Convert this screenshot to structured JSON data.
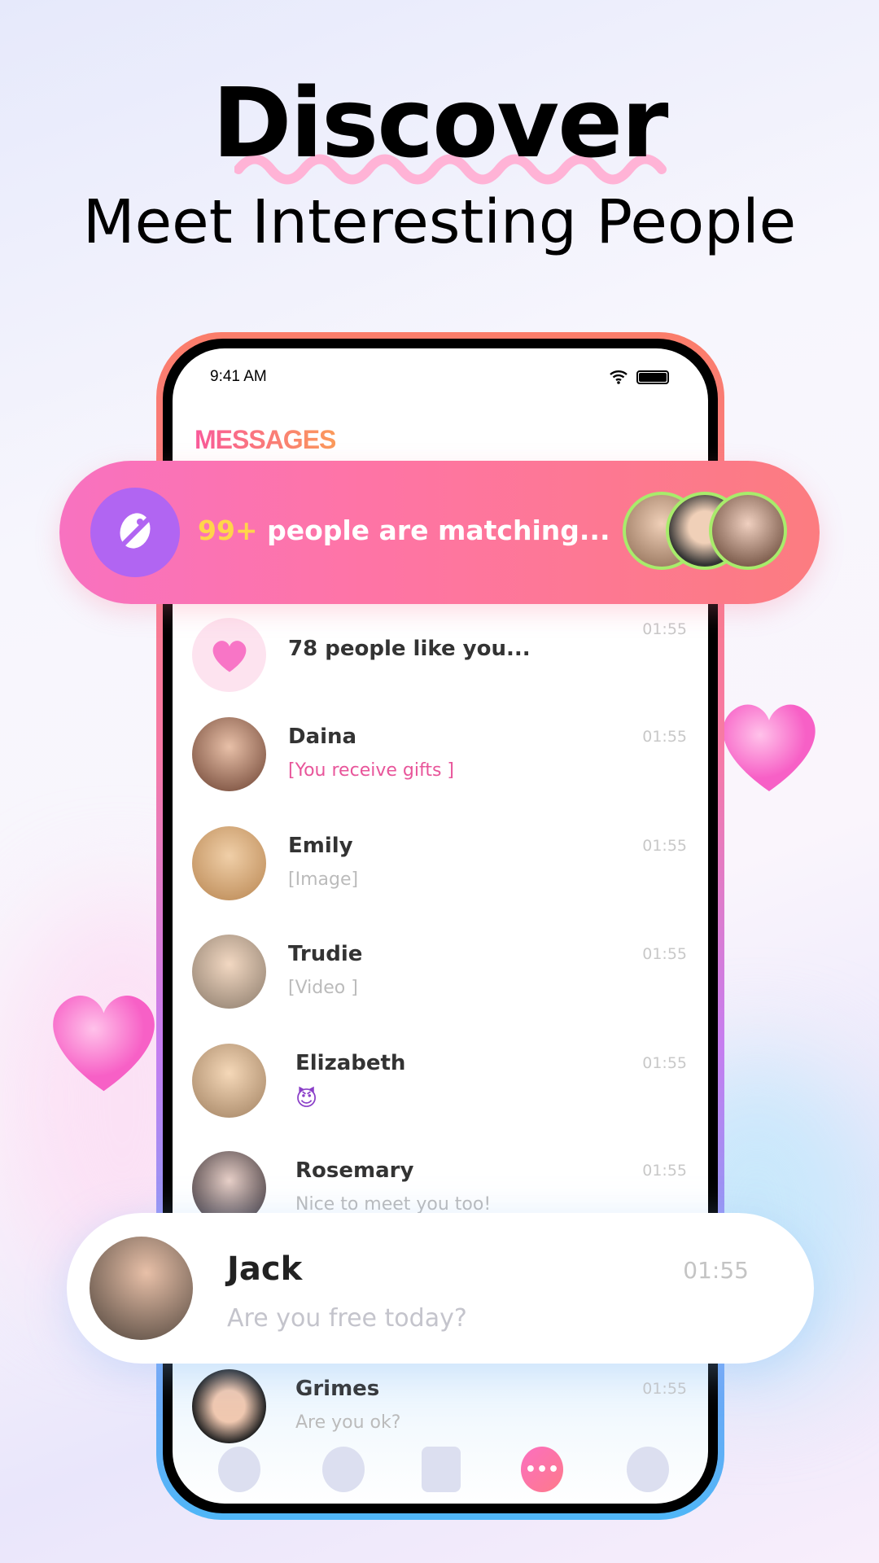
{
  "headline": {
    "title": "Discover",
    "subtitle": "Meet Interesting People"
  },
  "status_bar": {
    "time": "9:41 AM",
    "icons": [
      "wifi-icon",
      "battery-icon"
    ]
  },
  "screen": {
    "heading": "MESSAGES"
  },
  "matching_banner": {
    "count": "99+",
    "text": " people are matching...",
    "icon": "planet-icon"
  },
  "messages": [
    {
      "name": "78 people like you...",
      "message": "",
      "time": "01:55",
      "icon": "heart-icon"
    },
    {
      "name": "Daina",
      "message": "[You receive gifts ]",
      "time": "01:55",
      "highlight": true
    },
    {
      "name": "Emily",
      "message": "[Image]",
      "time": "01:55"
    },
    {
      "name": "Trudie",
      "message": "[Video ]",
      "time": "01:55"
    },
    {
      "name": "Elizabeth",
      "message": "😈",
      "time": "01:55"
    },
    {
      "name": "Rosemary",
      "message": "Nice to meet you too!",
      "time": "01:55"
    },
    {
      "name": "Grimes",
      "message": "Are you ok?",
      "time": "01:55"
    }
  ],
  "featured_message": {
    "name": "Jack",
    "message": "Are you free today?",
    "time": "01:55"
  },
  "tabs": [
    {
      "icon": "flame-icon",
      "active": false
    },
    {
      "icon": "planet-icon",
      "active": false
    },
    {
      "icon": "cards-icon",
      "active": false
    },
    {
      "icon": "chat-icon",
      "active": true
    },
    {
      "icon": "profile-icon",
      "active": false
    }
  ],
  "colors": {
    "accent_pink": "#fe74a6",
    "purple": "#b165f2",
    "highlight_yellow": "#ffd54a",
    "gift_pink": "#e8559a"
  }
}
